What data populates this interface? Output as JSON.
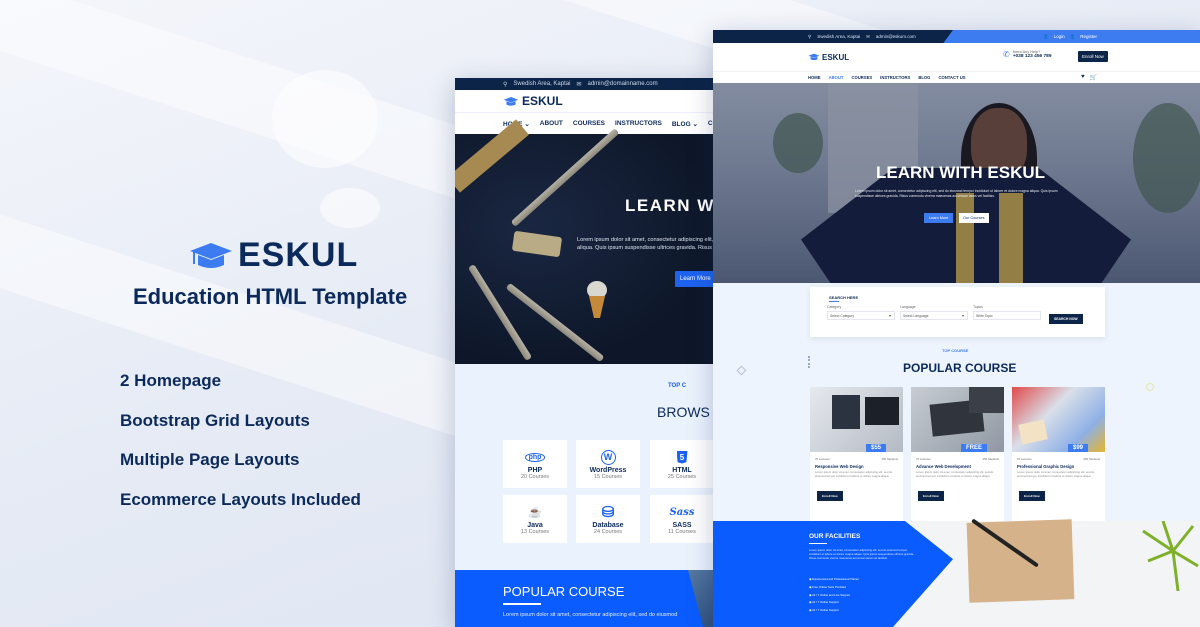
{
  "promo": {
    "brand_name": "ESKUL",
    "subtitle": "Education HTML Template",
    "features": [
      "2 Homepage",
      "Bootstrap Grid Layouts",
      "Multiple Page Layouts",
      "Ecommerce Layouts Included"
    ],
    "brand_color": "#0b2a5b",
    "accent_color": "#3d7cf0"
  },
  "screen1": {
    "topbar": {
      "location": "Swedish Area, Kaptai",
      "email": "admin@domainname.com"
    },
    "logo": "ESKUL",
    "nav": [
      "HOME",
      "ABOUT",
      "COURSES",
      "INSTRUCTORS",
      "BLOG",
      "CONT"
    ],
    "hero": {
      "title": "LEARN W",
      "text_line1": "Lorem ipsum dolor sit amet, consectetur adipiscing elit,",
      "text_line2": "aliqua. Quis ipsum suspendisse ultrices gravida. Risus",
      "button": "Learn More"
    },
    "section_label": "TOP C",
    "section_title": "BROWS C",
    "categories": [
      {
        "icon": "php",
        "name": "PHP",
        "count": "20 Courses"
      },
      {
        "icon": "W",
        "name": "WordPress",
        "count": "15 Courses"
      },
      {
        "icon": "5",
        "name": "HTML",
        "count": "25 Courses"
      },
      {
        "icon": "☕",
        "name": "Java",
        "count": "13 Courses"
      },
      {
        "icon": "⛁",
        "name": "Database",
        "count": "24 Courses"
      },
      {
        "icon": "Sass",
        "name": "SASS",
        "count": "11 Courses"
      }
    ],
    "popular": {
      "title": "POPULAR COURSE",
      "text": "Lorem ipsum dolor sit amet, consectetur adipiscing elit, sed do eiusmod"
    }
  },
  "screen2": {
    "topbar": {
      "location": "Swedish Area, Kaptai",
      "email": "admin@eskum.com",
      "login": "Login",
      "register": "Register"
    },
    "logo": "ESKUL",
    "call": {
      "label": "Need Any Help?",
      "phone": "+038 123 456 789"
    },
    "enroll_button": "Enroll Now",
    "nav": [
      "HOME",
      "ABOUT",
      "COURSES",
      "INSTRUCTORS",
      "BLOG",
      "CONTACT US"
    ],
    "nav_active": "ABOUT",
    "hero": {
      "title": "LEARN WITH ESKUL",
      "text": "Lorem ipsum dolor sit amet, consectetur adipiscing elit, sed do eiusmod tempor incididunt ut labore et dolore magna aliqua. Quis ipsum suspendisse ultrices gravida. Risus commodo viverra maecenas accumsan lacus vel facilisis.",
      "button1": "Learn More",
      "button2": "Our Courses"
    },
    "search": {
      "title": "SEARCH HERE",
      "fields": [
        {
          "label": "Category",
          "value": "Select Category"
        },
        {
          "label": "Language",
          "value": "Select Language"
        },
        {
          "label": "Topics",
          "value": "Write Topic"
        }
      ],
      "button": "SEARCH NOW"
    },
    "section_label": "TOP COURSE",
    "section_title": "POPULAR COURSE",
    "courses": [
      {
        "price": "$55",
        "lectures": "76 Lectures",
        "students": "250 Students",
        "title": "Responsive Web Design",
        "desc": "Lorem ipsum dolor sit amet, consectetur adipiscing elit, sed do eiusmod tempor incididunt ut labore et dolore magna aliqua.",
        "button": "Enroll Now"
      },
      {
        "price": "FREE",
        "lectures": "76 Lectures",
        "students": "250 Students",
        "title": "Advance Web Development",
        "desc": "Lorem ipsum dolor sit amet, consectetur adipiscing elit, sed do eiusmod tempor incididunt ut labore et dolore magna aliqua.",
        "button": "Enroll Now"
      },
      {
        "price": "$99",
        "lectures": "76 Lectures",
        "students": "250 Students",
        "title": "Professional Graphic Design",
        "desc": "Lorem ipsum dolor sit amet, consectetur adipiscing elit, sed do eiusmod tempor incididunt ut labore et dolore magna aliqua.",
        "button": "Enroll Now"
      }
    ],
    "facilities": {
      "title": "OUR FACILITIES",
      "text": "Lorem ipsum dolor sit amet, consectetur adipiscing elit, sed do eiusmod tempor incididunt ut labore et dolore magna aliqua. Quis ipsum suspendisse ultrices gravida. Risus commodo viverra maecenas accumsan lacus vel facilisis.",
      "items": [
        "Experienced and Professional Trainer",
        "Free Online Tools Provided",
        "24 / 7 Online and Live Support",
        "24 / 7 Online Support",
        "24 / 7 Online Support"
      ]
    }
  }
}
